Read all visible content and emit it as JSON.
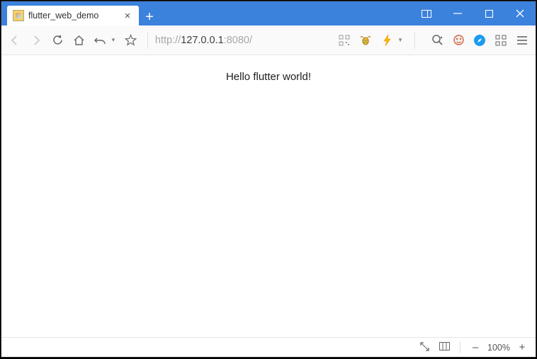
{
  "titlebar": {
    "tab_title": "flutter_web_demo"
  },
  "toolbar": {
    "url_protocol": "http://",
    "url_host": "127.0.0.1",
    "url_port": ":8080/",
    "url_full": "http://127.0.0.1:8080/"
  },
  "page": {
    "hello_text": "Hello flutter world!"
  },
  "statusbar": {
    "zoom_level": "100%"
  }
}
